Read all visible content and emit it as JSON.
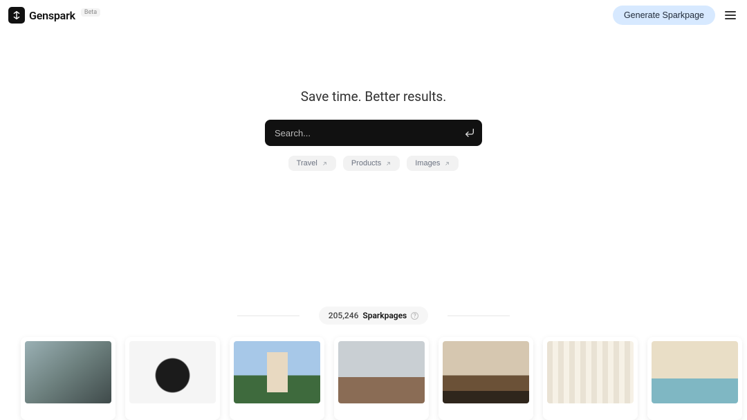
{
  "header": {
    "brand": "Genspark",
    "badge": "Beta",
    "generate_label": "Generate Sparkpage"
  },
  "hero": {
    "tagline": "Save time. Better results.",
    "search_placeholder": "Search..."
  },
  "chips": [
    {
      "label": "Travel"
    },
    {
      "label": "Products"
    },
    {
      "label": "Images"
    }
  ],
  "counter": {
    "count": "205,246",
    "label": "Sparkpages"
  }
}
